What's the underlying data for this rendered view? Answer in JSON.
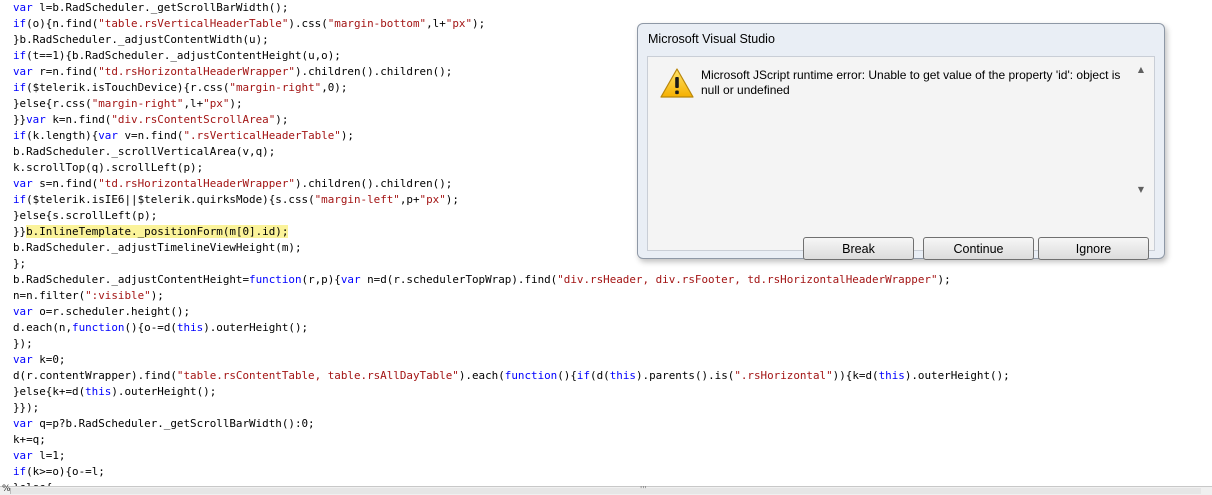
{
  "editor": {
    "lines": [
      [
        {
          "t": "var",
          "k": 1
        },
        {
          "t": " l=b.RadScheduler._getScrollBarWidth();"
        }
      ],
      [
        {
          "t": "if",
          "k": 1
        },
        {
          "t": "(o){n.find("
        },
        {
          "t": "\"table.rsVerticalHeaderTable\"",
          "s": 1
        },
        {
          "t": ").css("
        },
        {
          "t": "\"margin-bottom\"",
          "s": 1
        },
        {
          "t": ",l+"
        },
        {
          "t": "\"px\"",
          "s": 1
        },
        {
          "t": ");"
        }
      ],
      [
        {
          "t": "}b.RadScheduler._adjustContentWidth(u);"
        }
      ],
      [
        {
          "t": "if",
          "k": 1
        },
        {
          "t": "(t==1){b.RadScheduler._adjustContentHeight(u,o);"
        }
      ],
      [
        {
          "t": "var",
          "k": 1
        },
        {
          "t": " r=n.find("
        },
        {
          "t": "\"td.rsHorizontalHeaderWrapper\"",
          "s": 1
        },
        {
          "t": ").children().children();"
        }
      ],
      [
        {
          "t": "if",
          "k": 1
        },
        {
          "t": "($telerik.isTouchDevice){r.css("
        },
        {
          "t": "\"margin-right\"",
          "s": 1
        },
        {
          "t": ",0);"
        }
      ],
      [
        {
          "t": "}else{r.css("
        },
        {
          "t": "\"margin-right\"",
          "s": 1
        },
        {
          "t": ",l+"
        },
        {
          "t": "\"px\"",
          "s": 1
        },
        {
          "t": ");"
        }
      ],
      [
        {
          "t": "}}"
        },
        {
          "t": "var",
          "k": 1
        },
        {
          "t": " k=n.find("
        },
        {
          "t": "\"div.rsContentScrollArea\"",
          "s": 1
        },
        {
          "t": ");"
        }
      ],
      [
        {
          "t": "if",
          "k": 1
        },
        {
          "t": "(k.length){"
        },
        {
          "t": "var",
          "k": 1
        },
        {
          "t": " v=n.find("
        },
        {
          "t": "\".rsVerticalHeaderTable\"",
          "s": 1
        },
        {
          "t": ");"
        }
      ],
      [
        {
          "t": "b.RadScheduler._scrollVerticalArea(v,q);"
        }
      ],
      [
        {
          "t": "k.scrollTop(q).scrollLeft(p);"
        }
      ],
      [
        {
          "t": "var",
          "k": 1
        },
        {
          "t": " s=n.find("
        },
        {
          "t": "\"td.rsHorizontalHeaderWrapper\"",
          "s": 1
        },
        {
          "t": ").children().children();"
        }
      ],
      [
        {
          "t": "if",
          "k": 1
        },
        {
          "t": "($telerik.isIE6||$telerik.quirksMode){s.css("
        },
        {
          "t": "\"margin-left\"",
          "s": 1
        },
        {
          "t": ",p+"
        },
        {
          "t": "\"px\"",
          "s": 1
        },
        {
          "t": ");"
        }
      ],
      [
        {
          "t": "}else{s.scrollLeft(p);"
        }
      ],
      [
        {
          "t": "}}"
        },
        {
          "t": "b.InlineTemplate._positionForm(m[0].id);",
          "h": 1
        }
      ],
      [
        {
          "t": "b.RadScheduler._adjustTimelineViewHeight(m);"
        }
      ],
      [
        {
          "t": "};"
        }
      ],
      [
        {
          "t": "b.RadScheduler._adjustContentHeight="
        },
        {
          "t": "function",
          "k": 1
        },
        {
          "t": "(r,p){"
        },
        {
          "t": "var",
          "k": 1
        },
        {
          "t": " n=d(r.schedulerTopWrap).find("
        },
        {
          "t": "\"div.rsHeader, div.rsFooter, td.rsHorizontalHeaderWrapper\"",
          "s": 1
        },
        {
          "t": ");"
        }
      ],
      [
        {
          "t": "n=n.filter("
        },
        {
          "t": "\":visible\"",
          "s": 1
        },
        {
          "t": ");"
        }
      ],
      [
        {
          "t": "var",
          "k": 1
        },
        {
          "t": " o=r.scheduler.height();"
        }
      ],
      [
        {
          "t": "d.each(n,"
        },
        {
          "t": "function",
          "k": 1
        },
        {
          "t": "(){o-=d("
        },
        {
          "t": "this",
          "k": 1
        },
        {
          "t": ").outerHeight();"
        }
      ],
      [
        {
          "t": "});"
        }
      ],
      [
        {
          "t": "var",
          "k": 1
        },
        {
          "t": " k=0;"
        }
      ],
      [
        {
          "t": "d(r.contentWrapper).find("
        },
        {
          "t": "\"table.rsContentTable, table.rsAllDayTable\"",
          "s": 1
        },
        {
          "t": ").each("
        },
        {
          "t": "function",
          "k": 1
        },
        {
          "t": "(){"
        },
        {
          "t": "if",
          "k": 1
        },
        {
          "t": "(d("
        },
        {
          "t": "this",
          "k": 1
        },
        {
          "t": ").parents().is("
        },
        {
          "t": "\".rsHorizontal\"",
          "s": 1
        },
        {
          "t": ")){k=d("
        },
        {
          "t": "this",
          "k": 1
        },
        {
          "t": ").outerHeight();"
        }
      ],
      [
        {
          "t": "}else{k+=d("
        },
        {
          "t": "this",
          "k": 1
        },
        {
          "t": ").outerHeight();"
        }
      ],
      [
        {
          "t": "}});"
        }
      ],
      [
        {
          "t": "var",
          "k": 1
        },
        {
          "t": " q=p?b.RadScheduler._getScrollBarWidth():0;"
        }
      ],
      [
        {
          "t": "k+=q;"
        }
      ],
      [
        {
          "t": "var",
          "k": 1
        },
        {
          "t": " l=1;"
        }
      ],
      [
        {
          "t": "if",
          "k": 1
        },
        {
          "t": "(k>=o){o-=l;"
        }
      ],
      [
        {
          "t": "}else{"
        }
      ]
    ]
  },
  "statusbar": {
    "zoom": "%",
    "grip": "'''"
  },
  "dialog": {
    "title": "Microsoft Visual Studio",
    "message": "Microsoft JScript runtime error: Unable to get value of the property 'id': object is null or undefined",
    "buttons": {
      "break": "Break",
      "continue": "Continue",
      "ignore": "Ignore"
    },
    "icon": "warning-icon",
    "scroll_up": "▲",
    "scroll_down": "▼"
  },
  "colors": {
    "keyword": "#0000ff",
    "string": "#a31515",
    "highlight": "#fbf39a"
  }
}
